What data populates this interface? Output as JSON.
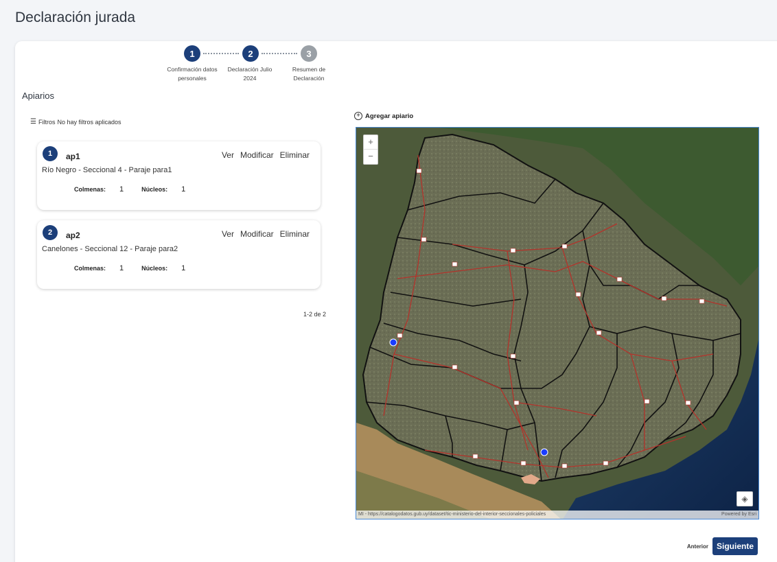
{
  "page": {
    "title": "Declaración jurada"
  },
  "stepper": {
    "steps": [
      {
        "number": "1",
        "label_line1": "Confirmación datos",
        "label_line2": "personales",
        "state": "completed"
      },
      {
        "number": "2",
        "label_line1": "Declaración Julio",
        "label_line2": "2024",
        "state": "active"
      },
      {
        "number": "3",
        "label_line1": "Resumen de",
        "label_line2": "Declaración",
        "state": "pending"
      }
    ]
  },
  "section": {
    "title": "Apiarios"
  },
  "filters": {
    "label": "Filtros",
    "status": "No hay filtros aplicados"
  },
  "apiarios": [
    {
      "number": "1",
      "name": "ap1",
      "location": "Río Negro - Seccional 4 - Paraje para1",
      "colmenas_label": "Colmenas:",
      "colmenas": "1",
      "nucleos_label": "Núcleos:",
      "nucleos": "1"
    },
    {
      "number": "2",
      "name": "ap2",
      "location": "Canelones - Seccional 12 - Paraje para2",
      "colmenas_label": "Colmenas:",
      "colmenas": "1",
      "nucleos_label": "Núcleos:",
      "nucleos": "1"
    }
  ],
  "card_actions": {
    "view": "Ver",
    "edit": "Modificar",
    "delete": "Eliminar"
  },
  "pagination": {
    "text": "1-2 de 2"
  },
  "map": {
    "add_label": "Agregar apiario",
    "zoom_in": "+",
    "zoom_out": "−",
    "attribution_left": "MI - https://catalogodatos.gub.uy/dataset/tic-ministerio-del-interior-seccionales-policiales",
    "attribution_right": "Powered by Esri",
    "layers_icon": "layers-icon"
  },
  "navigation": {
    "previous": "Anterior",
    "next": "Siguiente"
  },
  "colors": {
    "primary": "#1c3f7a",
    "step_inactive": "#9aa0a6",
    "marker": "#1a3cff",
    "road": "#b3332b"
  }
}
